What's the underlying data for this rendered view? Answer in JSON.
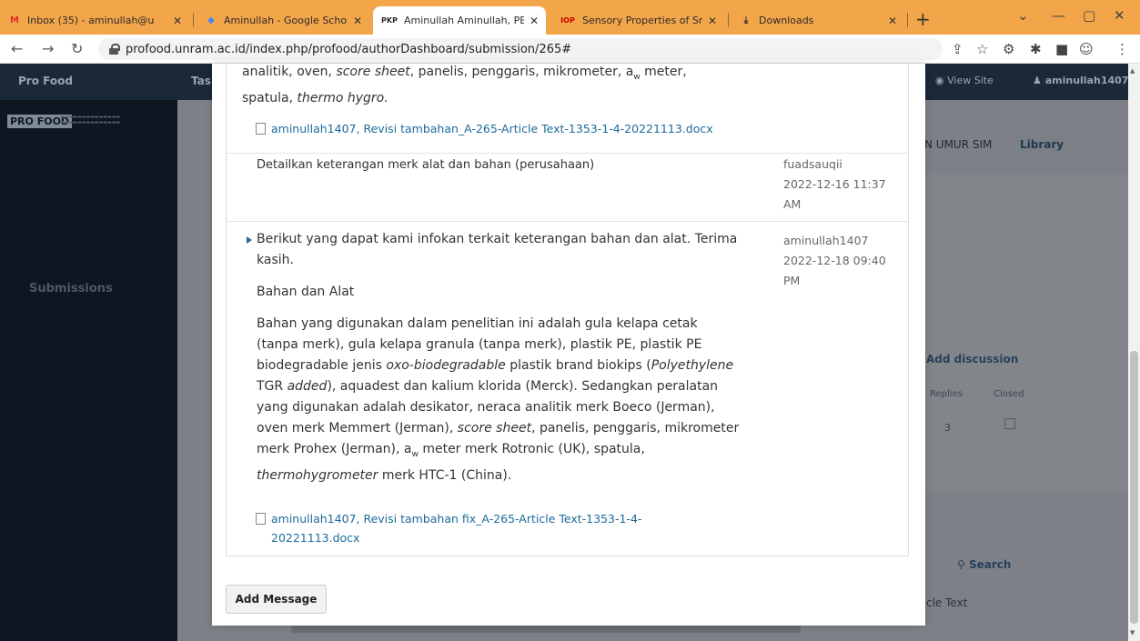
{
  "browser": {
    "tabs": [
      {
        "title": "Inbox (35) - aminullah@u",
        "favicon": "gmail-icon"
      },
      {
        "title": "Aminullah - Google Schol",
        "favicon": "scholar-icon"
      },
      {
        "title": "Aminullah Aminullah, PEN",
        "favicon": "pkp-icon"
      },
      {
        "title": "Sensory Properties of Sna",
        "favicon": "iop-icon"
      },
      {
        "title": "Downloads",
        "favicon": "download-icon"
      }
    ],
    "favicon_text": {
      "pkp": "PKP",
      "iop": "IOP"
    },
    "url": "profood.unram.ac.id/index.php/profood/authorDashboard/submission/265#"
  },
  "app": {
    "site_name": "Pro Food",
    "tasks_label": "Tas",
    "view_site": "View Site",
    "user": "aminullah1407",
    "logo": "PRO FOOD",
    "sidebar_submissions": "Submissions",
    "bg_library": "Library",
    "bg_umur": "N UMUR SIM",
    "bg_add_discussion": "Add discussion",
    "bg_replies": "Replies",
    "bg_closed": "Closed",
    "bg_count": "3",
    "bg_search": "Search",
    "bg_article_text": "cle Text"
  },
  "discussion": {
    "msg0_line1_prefix": "analitik, oven, ",
    "msg0_line1_italic": "score sheet",
    "msg0_line1_rest": ", panelis, penggaris, mikrometer, a",
    "msg0_sub": "w",
    "msg0_line1_end": " meter,",
    "msg0_line2_a": "spatula, ",
    "msg0_line2_italic": "thermo hygro.",
    "file1": "aminullah1407, Revisi tambahan_A-265-Article Text-1353-1-4-20221113.docx",
    "msg1_text": "Detailkan keterangan merk alat dan bahan (perusahaan)",
    "msg1_author": "fuadsauqii",
    "msg1_date": "2022-12-16 11:37",
    "msg1_time_suffix": "AM",
    "msg2_line1": "Berikut yang dapat kami infokan terkait keterangan bahan dan alat. Terima",
    "msg2_line2": "kasih.",
    "msg2_heading": "Bahan dan Alat",
    "msg2_p_l1": "Bahan yang digunakan dalam penelitian ini adalah gula kelapa cetak",
    "msg2_p_l2": "(tanpa merk), gula kelapa granula (tanpa merk), plastik PE, plastik PE",
    "msg2_p_l3a": "biodegradable jenis ",
    "msg2_p_l3b": "oxo-biodegradable",
    "msg2_p_l3c": " plastik brand biokips (",
    "msg2_p_l3d": "Polyethylene",
    "msg2_p_l4a": "TGR ",
    "msg2_p_l4b": "added",
    "msg2_p_l4c": "), aquadest dan kalium klorida (Merck). Sedangkan peralatan",
    "msg2_p_l5": "yang digunakan adalah desikator, neraca analitik merk Boeco (Jerman),",
    "msg2_p_l6a": "oven merk Memmert (Jerman), ",
    "msg2_p_l6b": "score sheet",
    "msg2_p_l6c": ", panelis, penggaris, mikrometer",
    "msg2_p_l7a": "merk Prohex (Jerman), a",
    "msg2_p_l7sub": "w",
    "msg2_p_l7b": " meter merk Rotronic (UK), spatula,",
    "msg2_p_l8a": "thermohygrometer",
    "msg2_p_l8b": " merk HTC-1 (China).",
    "msg2_author": "aminullah1407",
    "msg2_date": "2022-12-18 09:40",
    "msg2_time_suffix": "PM",
    "file2_l1": "aminullah1407, Revisi tambahan fix_A-265-Article Text-1353-1-4-",
    "file2_l2": "20221113.docx",
    "add_message": "Add Message"
  }
}
